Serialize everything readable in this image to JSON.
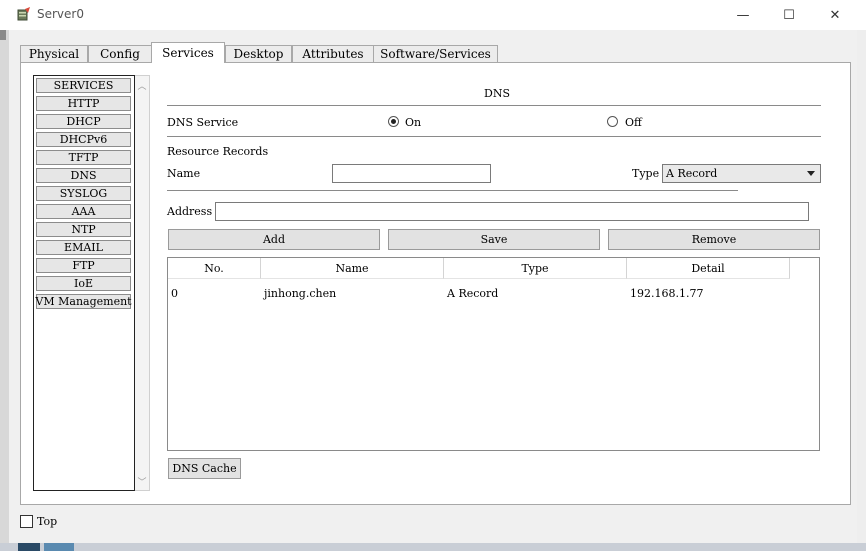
{
  "window": {
    "title": "Server0",
    "minimize_glyph": "—",
    "maximize_glyph": "☐",
    "close_glyph": "✕"
  },
  "tabs": [
    {
      "label": "Physical",
      "active": false
    },
    {
      "label": "Config",
      "active": false
    },
    {
      "label": "Services",
      "active": true
    },
    {
      "label": "Desktop",
      "active": false
    },
    {
      "label": "Attributes",
      "active": false
    },
    {
      "label": "Software/Services",
      "active": false
    }
  ],
  "services": {
    "items": [
      "SERVICES",
      "HTTP",
      "DHCP",
      "DHCPv6",
      "TFTP",
      "DNS",
      "SYSLOG",
      "AAA",
      "NTP",
      "EMAIL",
      "FTP",
      "IoE",
      "VM Management"
    ],
    "scroll_up": "︿",
    "scroll_down": "﹀"
  },
  "dns": {
    "heading": "DNS",
    "service_label": "DNS Service",
    "on_label": "On",
    "off_label": "Off",
    "service_state": "On",
    "resource_records_label": "Resource Records",
    "name_label": "Name",
    "name_value": "",
    "type_label": "Type",
    "type_value": "A Record",
    "address_label": "Address",
    "address_value": "",
    "buttons": {
      "add": "Add",
      "save": "Save",
      "remove": "Remove"
    },
    "table": {
      "columns": [
        "No.",
        "Name",
        "Type",
        "Detail"
      ],
      "rows": [
        {
          "no": "0",
          "name": "jinhong.chen",
          "type": "A Record",
          "detail": "192.168.1.77"
        }
      ]
    },
    "cache_button": "DNS Cache"
  },
  "footer": {
    "top_label": "Top",
    "top_checked": false
  },
  "colors": {
    "client_bg": "#f0f0f0",
    "panel_bg": "#ffffff",
    "border": "#a8a8a8"
  }
}
